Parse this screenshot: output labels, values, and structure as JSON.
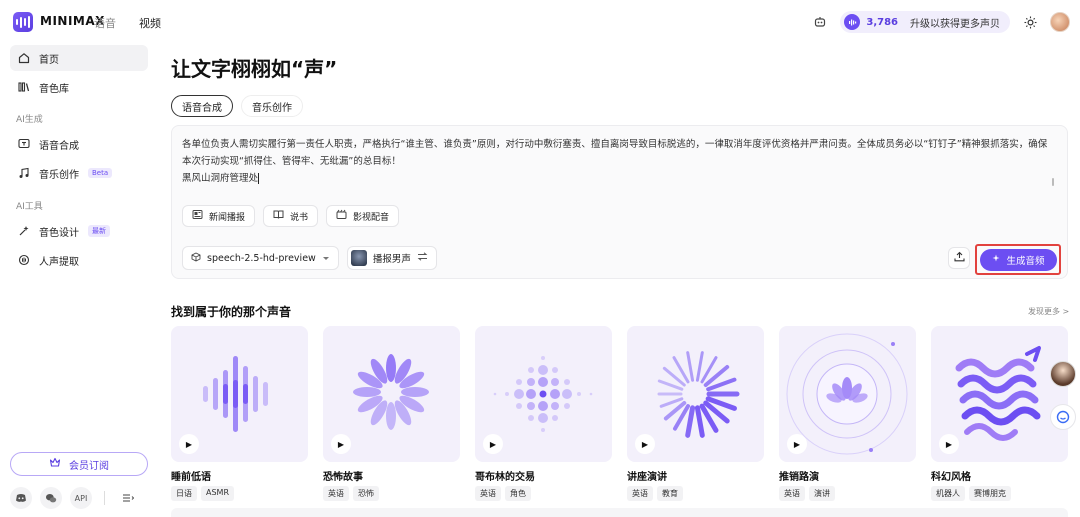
{
  "header": {
    "logo_text": "MINIMAX",
    "nav_voice": "语音",
    "nav_video": "视频",
    "credits": "3,786",
    "upgrade_text": "升级以获得更多声贝"
  },
  "sidebar": {
    "items_top": [
      {
        "label": "首页",
        "icon": "home-icon"
      },
      {
        "label": "音色库",
        "icon": "library-icon"
      }
    ],
    "section_generate": "AI生成",
    "items_generate": [
      {
        "label": "语音合成",
        "icon": "tts-icon"
      },
      {
        "label": "音乐创作",
        "icon": "music-icon",
        "badge": "Beta"
      }
    ],
    "section_tools": "AI工具",
    "items_tools": [
      {
        "label": "音色设计",
        "icon": "voice-design-icon",
        "badge": "最新"
      },
      {
        "label": "人声提取",
        "icon": "vocal-extract-icon"
      }
    ],
    "member_button": "会员订阅",
    "footer_api": "API"
  },
  "main": {
    "title": "让文字栩栩如“声”",
    "tabs": [
      "语音合成",
      "音乐创作"
    ],
    "editor": {
      "line1": "各单位负责人需切实履行第一责任人职责，严格执行“谁主管、谁负责”原则，对行动中敷衍塞责、擅自离岗导致目标脱逃的，一律取消年度评优资格并严肃问责。全体成员务必以“钉钉子”精神狠抓落实，确",
      "line2": "保本次行动实现“抓得住、管得牢、无纰漏”的总目标！",
      "line3": "黑风山洞府管理处"
    },
    "chips": [
      "新闻播报",
      "说书",
      "影视配音"
    ],
    "model": "speech-2.5-hd-preview",
    "voice": "播报男声",
    "generate_button": "生成音频",
    "section_title": "找到属于你的那个声音",
    "more_link": "发现更多 >"
  },
  "cards": [
    {
      "name": "睡前低语",
      "tags": [
        "日语",
        "ASMR"
      ]
    },
    {
      "name": "恐怖故事",
      "tags": [
        "英语",
        "恐怖"
      ]
    },
    {
      "name": "哥布林的交易",
      "tags": [
        "英语",
        "角色"
      ]
    },
    {
      "name": "讲座演讲",
      "tags": [
        "英语",
        "教育"
      ]
    },
    {
      "name": "推销路演",
      "tags": [
        "英语",
        "演讲"
      ]
    },
    {
      "name": "科幻风格",
      "tags": [
        "机器人",
        "赛博朋克"
      ]
    }
  ],
  "colors": {
    "accent": "#6c4ef2",
    "highlight_frame": "#e2423e",
    "card_bg": "#f3f0fb"
  }
}
